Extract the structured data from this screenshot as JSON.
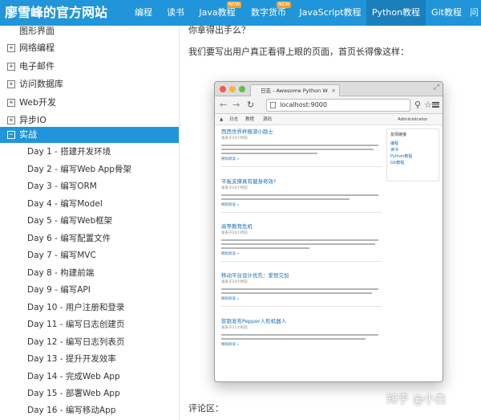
{
  "header": {
    "site_title": "廖雪峰的官方网站",
    "nav": [
      {
        "label": "编程",
        "badge": ""
      },
      {
        "label": "读书",
        "badge": ""
      },
      {
        "label": "Java教程",
        "badge": "NEW"
      },
      {
        "label": "数字货币",
        "badge": "NEW"
      },
      {
        "label": "JavaScript教程",
        "badge": ""
      },
      {
        "label": "Python教程",
        "badge": ""
      },
      {
        "label": "Git教程",
        "badge": ""
      },
      {
        "label": "问",
        "badge": ""
      }
    ]
  },
  "sidebar": {
    "top_item": "图形界面",
    "sections": [
      {
        "label": "网络编程",
        "toggle": "+"
      },
      {
        "label": "电子邮件",
        "toggle": "+"
      },
      {
        "label": "访问数据库",
        "toggle": "+"
      },
      {
        "label": "Web开发",
        "toggle": "+"
      },
      {
        "label": "异步IO",
        "toggle": "+"
      },
      {
        "label": "实战",
        "toggle": "−"
      }
    ],
    "days": [
      "Day 1 - 搭建开发环境",
      "Day 2 - 编写Web App骨架",
      "Day 3 - 编写ORM",
      "Day 4 - 编写Model",
      "Day 5 - 编写Web框架",
      "Day 6 - 编写配置文件",
      "Day 7 - 编写MVC",
      "Day 8 - 构建前端",
      "Day 9 - 编写API",
      "Day 10 - 用户注册和登录",
      "Day 11 - 编写日志创建页",
      "Day 12 - 编写日志列表页",
      "Day 13 - 提升开发效率",
      "Day 14 - 完成Web App",
      "Day 15 - 部署Web App",
      "Day 16 - 编写移动App"
    ]
  },
  "content": {
    "partial_line": "你拿得出手么？",
    "intro": "我们要写出用户真正看得上眼的页面，首页长得像这样：",
    "comments_label": "评论区：",
    "watermark": "知乎 @小白"
  },
  "mockup": {
    "tab_title": "日志 - Awesome Python W",
    "tab_close": "×",
    "url": "localhost:9000",
    "appnav": [
      "日志",
      "教程",
      "源码"
    ],
    "user": "Administrator",
    "posts": [
      {
        "title": "西西世界杯报游小励士",
        "meta": "发表于10小时前",
        "more": "继续阅读 »"
      },
      {
        "title": "平板支撑真有健身奇效?",
        "meta": "发表于10小时前",
        "more": "继续阅读 »"
      },
      {
        "title": "高等教育危机",
        "meta": "发表于10小时前",
        "more": "继续阅读 »"
      },
      {
        "title": "移动平台设计优先：爱恨交加",
        "meta": "发表于10小时前",
        "more": "继续阅读 »"
      },
      {
        "title": "软银发布Pepper人形机器人",
        "meta": "发表于11小时前",
        "more": "继续阅读 »"
      }
    ],
    "sidebox_title": "友情链接",
    "sidebox_links": [
      "编程",
      "读书",
      "Python教程",
      "Git教程"
    ]
  },
  "colors": {
    "nav_bg": "#2195d9",
    "nav_active": "#1a7fbb",
    "sidebar_active": "#2195d9",
    "link": "#1a6fb5"
  }
}
